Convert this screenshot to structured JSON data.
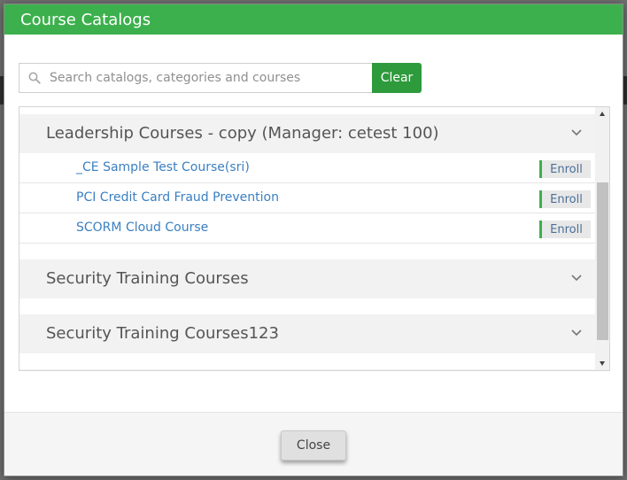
{
  "modal": {
    "title": "Course Catalogs"
  },
  "search": {
    "placeholder": "Search catalogs, categories and courses",
    "value": "",
    "clear_label": "Clear"
  },
  "catalogs": [
    {
      "title": "Leadership Courses - copy (Manager: cetest 100)",
      "expanded": true,
      "courses": [
        {
          "name": "_CE Sample Test Course(sri)",
          "action": "Enroll"
        },
        {
          "name": "PCI Credit Card Fraud Prevention",
          "action": "Enroll"
        },
        {
          "name": "SCORM Cloud Course",
          "action": "Enroll"
        }
      ]
    },
    {
      "title": "Security Training Courses",
      "expanded": false
    },
    {
      "title": "Security Training Courses123",
      "expanded": false
    }
  ],
  "footer": {
    "close_label": "Close"
  },
  "colors": {
    "header_green": "#3cb04c",
    "button_green": "#2d9a3c",
    "link_blue": "#3a7fc1",
    "enroll_accent": "#3cb04c"
  },
  "icons": {
    "search": "search-icon",
    "expand": "chevron-down-icon",
    "scroll_up": "scroll-up-arrow-icon",
    "scroll_down": "scroll-down-arrow-icon"
  }
}
